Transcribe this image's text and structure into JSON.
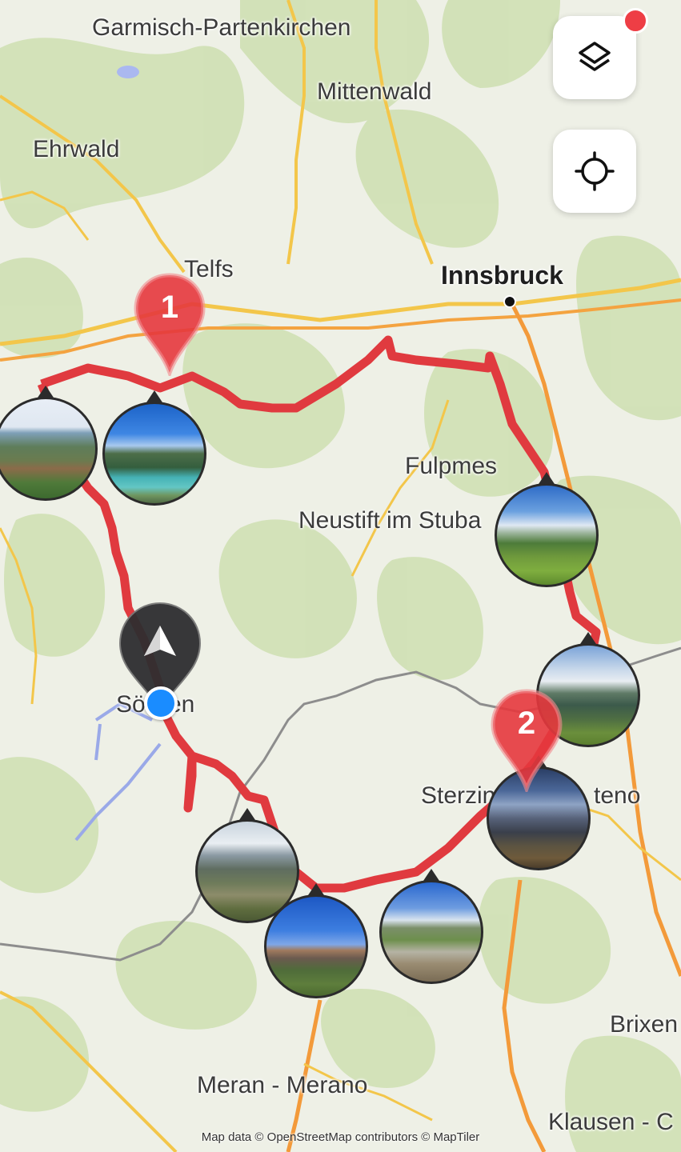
{
  "map": {
    "route_color": "#e03a3f",
    "waypoint_color": "#e5373d",
    "location_dot_color": "#1a8cff",
    "nav_pin_color": "#2e2e30",
    "places": [
      {
        "name": "Garmisch-Partenkirchen",
        "major": false
      },
      {
        "name": "Mittenwald",
        "major": false
      },
      {
        "name": "Ehrwald",
        "major": false
      },
      {
        "name": "Telfs",
        "major": false
      },
      {
        "name": "Innsbruck",
        "major": true
      },
      {
        "name": "Fulpmes",
        "major": false
      },
      {
        "name": "Neustift im Stuba",
        "major": false
      },
      {
        "name": "Sö",
        "major": false
      },
      {
        "name": "en",
        "major": false
      },
      {
        "name": "Sterzin",
        "major": false
      },
      {
        "name": "teno",
        "major": false
      },
      {
        "name": "Brixen",
        "major": false
      },
      {
        "name": "Meran - Merano",
        "major": false
      },
      {
        "name": "Klausen - C",
        "major": false
      }
    ],
    "waypoints": [
      {
        "label": "1"
      },
      {
        "label": "2"
      }
    ],
    "attribution": "Map data © OpenStreetMap contributors © MapTiler"
  },
  "controls": {
    "layers_icon": "layers-icon",
    "locate_icon": "crosshair-icon",
    "notification_dot_color": "#ee3e45"
  }
}
